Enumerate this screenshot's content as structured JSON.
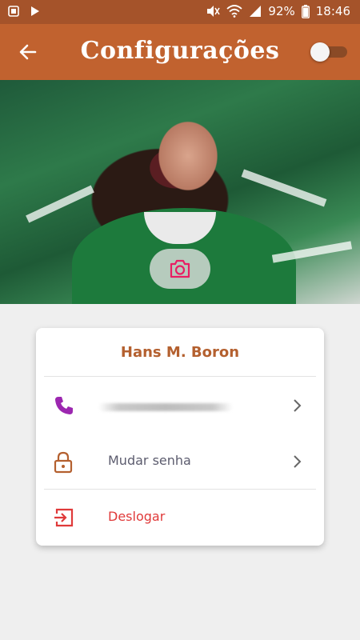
{
  "status_bar": {
    "battery": "92%",
    "time": "18:46"
  },
  "app_bar": {
    "title": "Configurações",
    "dark_mode_toggle": {
      "on": false
    }
  },
  "profile": {
    "name": "Hans M. Boron"
  },
  "menu": {
    "change_password": "Mudar senha",
    "logout": "Deslogar"
  },
  "colors": {
    "primary": "#c1622f",
    "status_bar": "#a5532a",
    "accent_phone": "#9c27b0",
    "logout_red": "#e03a3a",
    "camera_pink": "#e91e63"
  },
  "icons": {
    "back": "arrow-left-icon",
    "camera": "camera-icon",
    "phone": "phone-icon",
    "lock": "lock-icon",
    "logout": "logout-icon",
    "chevron": "chevron-right-icon"
  }
}
